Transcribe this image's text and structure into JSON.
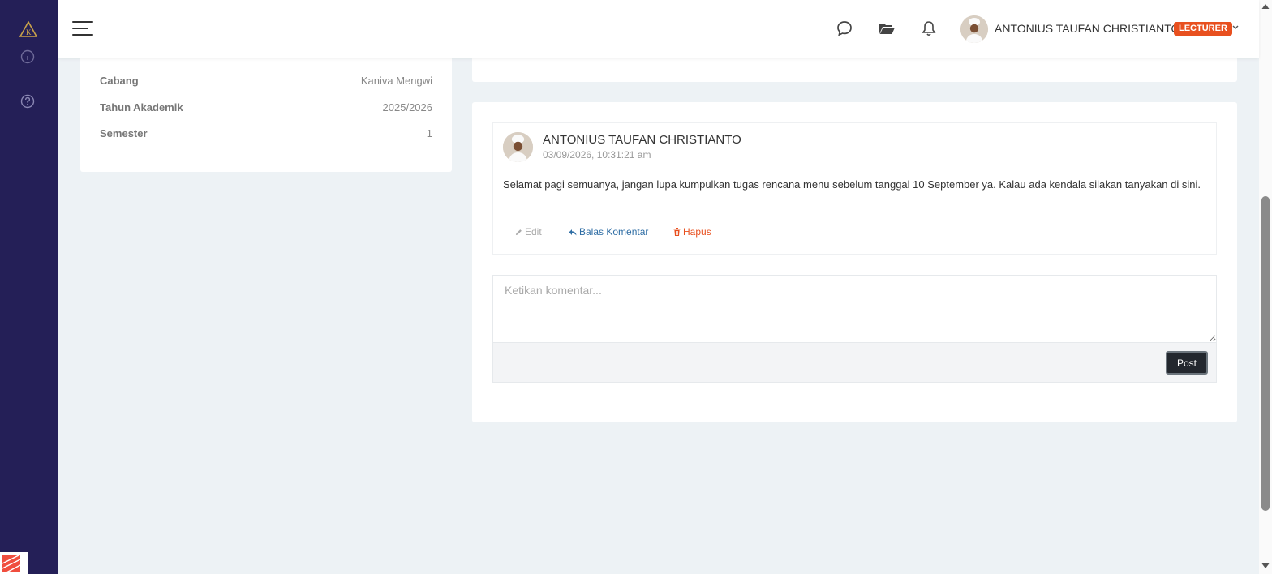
{
  "header": {
    "user_name": "ANTONIUS TAUFAN CHRISTIANTO",
    "role_badge": "LECTURER"
  },
  "class_info": {
    "rows": [
      {
        "label": "Cabang",
        "value": "Kaniva Mengwi"
      },
      {
        "label": "Tahun Akademik",
        "value": "2025/2026"
      },
      {
        "label": "Semester",
        "value": "1"
      }
    ]
  },
  "comment": {
    "author": "ANTONIUS TAUFAN CHRISTIANTO",
    "date": "03/09/2026, 10:31:21 am",
    "text": "Selamat pagi semuanya, jangan lupa kumpulkan tugas rencana menu sebelum tanggal 10 September ya. Kalau ada kendala silakan tanyakan di sini.",
    "actions": {
      "edit": "Edit",
      "reply": "Balas Komentar",
      "delete": "Hapus"
    }
  },
  "new_comment": {
    "placeholder": "Ketikan komentar...",
    "post_label": "Post"
  },
  "colors": {
    "sidebar": "#241f57",
    "accent_orange": "#e8501f",
    "link_blue": "#2e6da4",
    "page_bg": "#edf2f5"
  },
  "icons": {
    "logo": "brand-logo-icon",
    "menu": "hamburger-menu-icon",
    "chat": "chat-bubble-icon",
    "files": "folder-open-icon",
    "notifications": "bell-icon",
    "help": "question-circle-icon"
  }
}
